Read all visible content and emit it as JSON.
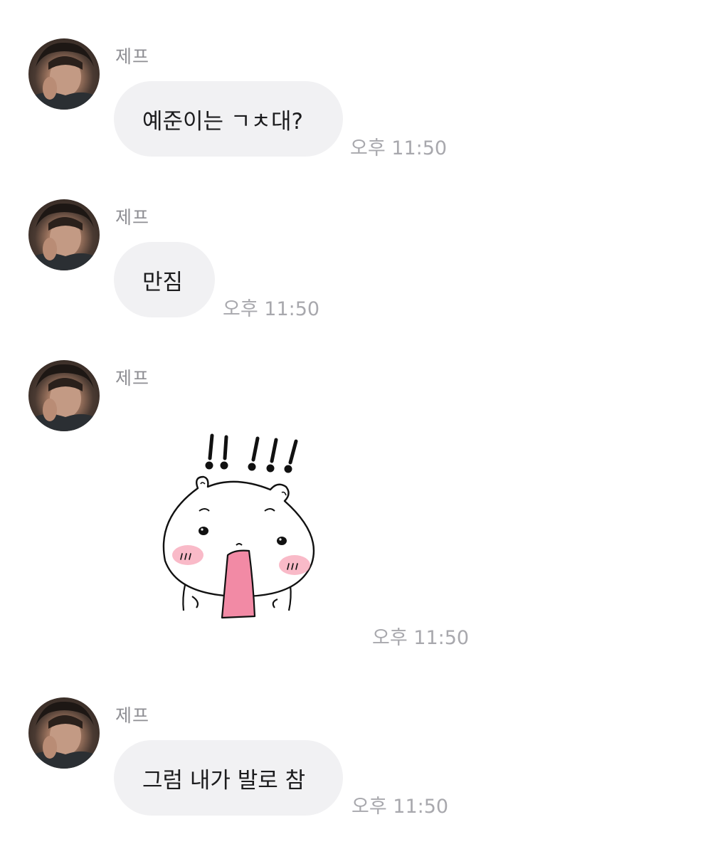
{
  "chat": {
    "messages": [
      {
        "sender": "제프",
        "type": "text",
        "text": "예준이는 ㄱㅊ대?",
        "time": "오후 11:50"
      },
      {
        "sender": "제프",
        "type": "text",
        "text": "만짐",
        "time": "오후 11:50"
      },
      {
        "sender": "제프",
        "type": "sticker",
        "sticker": {
          "caption": "!!!!!",
          "description": "white-hamster-blushing-sticker"
        },
        "time": "오후 11:50"
      },
      {
        "sender": "제프",
        "type": "text",
        "text": "그럼 내가 발로 참",
        "time": "오후 11:50"
      }
    ]
  },
  "colors": {
    "bubble": "#f1f1f3",
    "sender": "#8e8e93",
    "time": "#a8a8ad",
    "text": "#1c1c1e",
    "tongue": "#f28aa5",
    "blush": "#f7a3b5"
  }
}
